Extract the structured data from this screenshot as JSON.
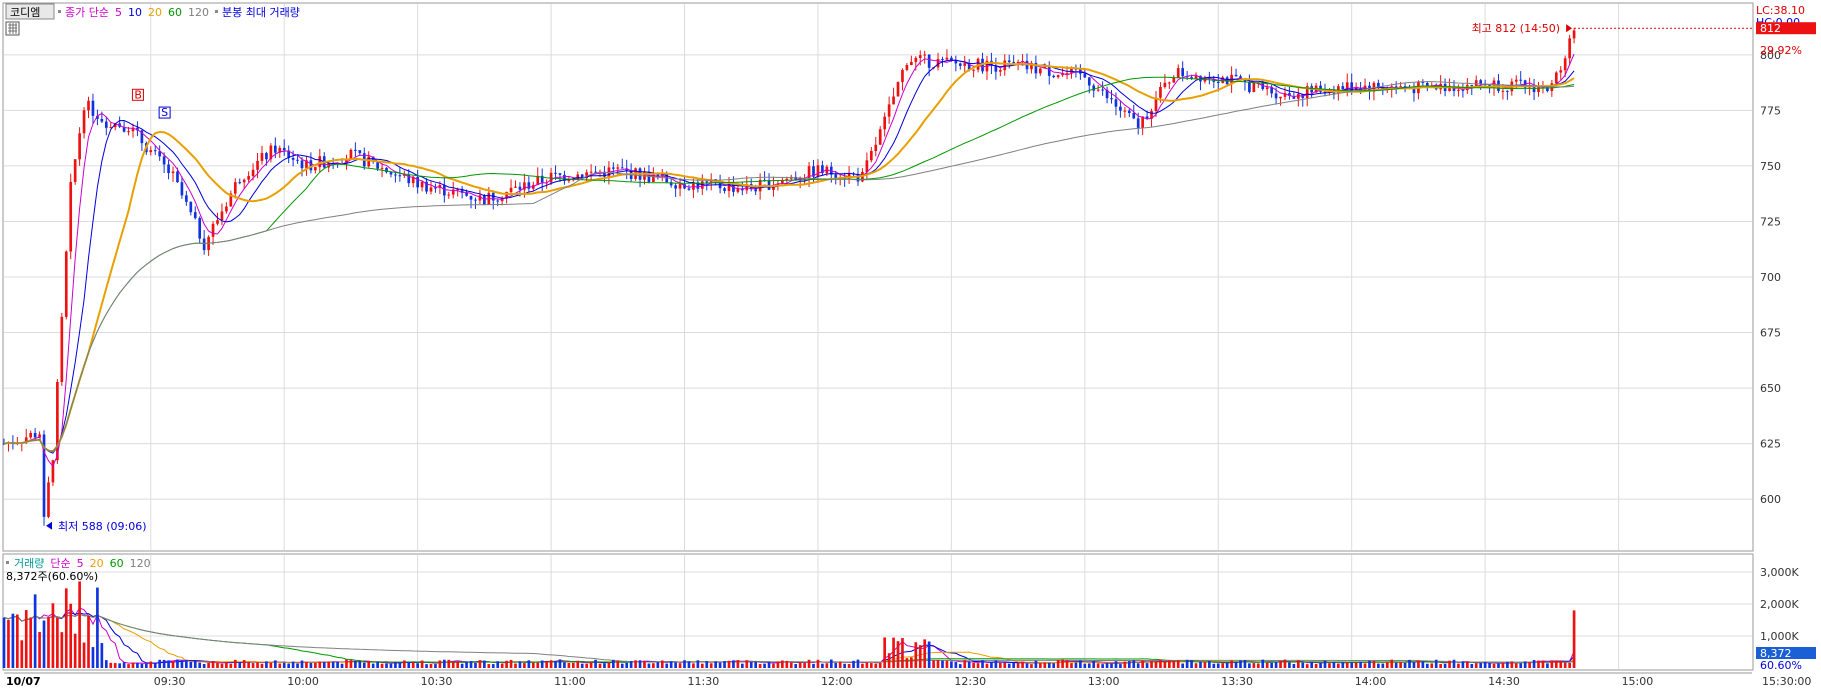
{
  "header": {
    "stock_name": "코디엠",
    "price_legend": [
      {
        "text": "종가 단순",
        "color": "#cc00cc"
      },
      {
        "text": "5",
        "color": "#cc00cc"
      },
      {
        "text": "10",
        "color": "#0000dd"
      },
      {
        "text": "20",
        "color": "#e8a000"
      },
      {
        "text": "60",
        "color": "#009900"
      },
      {
        "text": "120",
        "color": "#808080"
      }
    ],
    "bunbong_label": "분봉 최대 거래량",
    "volume_legend": [
      {
        "text": "거래량",
        "color": "#009999"
      },
      {
        "text": "단순",
        "color": "#cc00cc"
      },
      {
        "text": "5",
        "color": "#cc00cc"
      },
      {
        "text": "20",
        "color": "#e8a000"
      },
      {
        "text": "60",
        "color": "#009900"
      },
      {
        "text": "120",
        "color": "#808080"
      }
    ],
    "volume_readout": "8,372주(60.60%)"
  },
  "right_axis": {
    "lc": "LC:38.10",
    "hc": "HC:0.00",
    "price_badge": "812",
    "pct": "29.92%",
    "vol_badge": "8,372",
    "vol_pct": "60.60%",
    "end_time": "15:30:00"
  },
  "colors": {
    "up": "#ee1111",
    "down": "#1133dd",
    "grid": "#dcdcdc",
    "ma5": "#cc00cc",
    "ma10": "#0000dd",
    "ma20": "#e8a000",
    "ma60": "#009900",
    "ma120": "#808080"
  },
  "chart_data": {
    "type": "candlestick",
    "price_ylim": [
      578,
      822
    ],
    "price_ticks": [
      600,
      625,
      650,
      675,
      700,
      725,
      750,
      775,
      800
    ],
    "volume_ylim": [
      0,
      3500
    ],
    "volume_ticks": [
      "1,000K",
      "2,000K",
      "3,000K"
    ],
    "volume_tick_values": [
      1000,
      2000,
      3000
    ],
    "x_start": "08:57",
    "x_end": "15:30",
    "date_label": "10/07",
    "x_ticks": [
      "09:30",
      "10:00",
      "10:30",
      "11:00",
      "11:30",
      "12:00",
      "12:30",
      "13:00",
      "13:30",
      "14:00",
      "14:30",
      "15:00"
    ],
    "x_tick_minutes": [
      570,
      600,
      630,
      660,
      690,
      720,
      750,
      780,
      810,
      840,
      870,
      900
    ],
    "annotations": {
      "low": {
        "text": "최저 588 (09:06)",
        "price": 588,
        "time": "09:06"
      },
      "high": {
        "text": "최고 812 (14:50)",
        "price": 812,
        "time": "14:50"
      },
      "marker_b": "B",
      "marker_s": "S"
    },
    "trend_anchors": [
      [
        "08:57",
        625
      ],
      [
        "09:05",
        630
      ],
      [
        "09:06",
        592
      ],
      [
        "09:08",
        620
      ],
      [
        "09:12",
        740
      ],
      [
        "09:15",
        778
      ],
      [
        "09:20",
        770
      ],
      [
        "09:25",
        768
      ],
      [
        "09:35",
        745
      ],
      [
        "09:42",
        715
      ],
      [
        "09:50",
        745
      ],
      [
        "09:58",
        758
      ],
      [
        "10:05",
        750
      ],
      [
        "10:15",
        755
      ],
      [
        "10:30",
        742
      ],
      [
        "10:45",
        735
      ],
      [
        "11:00",
        745
      ],
      [
        "11:15",
        748
      ],
      [
        "11:30",
        742
      ],
      [
        "11:45",
        740
      ],
      [
        "12:00",
        748
      ],
      [
        "12:10",
        745
      ],
      [
        "12:15",
        770
      ],
      [
        "12:20",
        798
      ],
      [
        "12:30",
        796
      ],
      [
        "12:45",
        795
      ],
      [
        "13:00",
        790
      ],
      [
        "13:08",
        775
      ],
      [
        "13:12",
        768
      ],
      [
        "13:20",
        792
      ],
      [
        "13:30",
        790
      ],
      [
        "13:45",
        782
      ],
      [
        "14:00",
        786
      ],
      [
        "14:15",
        785
      ],
      [
        "14:30",
        787
      ],
      [
        "14:45",
        785
      ],
      [
        "14:50",
        812
      ]
    ]
  }
}
